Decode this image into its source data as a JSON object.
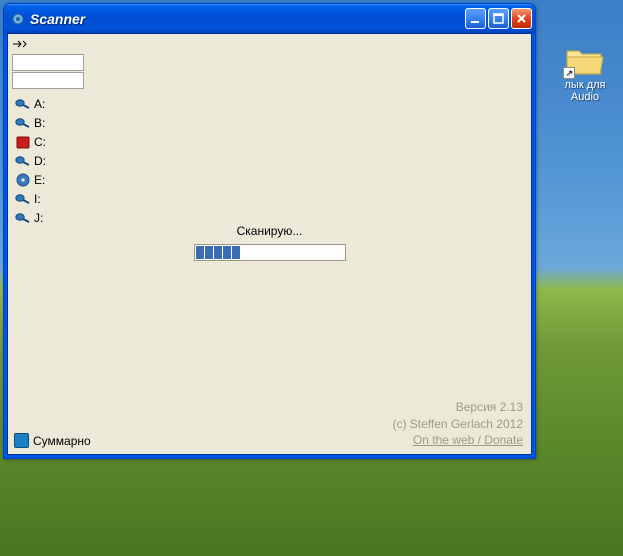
{
  "desktop": {
    "icon_label_line1": "лык для",
    "icon_label_line2": "Audio"
  },
  "window": {
    "title": "Scanner"
  },
  "drives": [
    {
      "label": "A:",
      "icon": "scanner"
    },
    {
      "label": "B:",
      "icon": "scanner"
    },
    {
      "label": "C:",
      "icon": "hdd-red"
    },
    {
      "label": "D:",
      "icon": "scanner"
    },
    {
      "label": "E:",
      "icon": "cd"
    },
    {
      "label": "I:",
      "icon": "scanner"
    },
    {
      "label": "J:",
      "icon": "scanner"
    }
  ],
  "scanning": {
    "label": "Сканирую...",
    "progress_segments": 5,
    "progress_max_segments": 16
  },
  "footer": {
    "summary_label": "Суммарно",
    "version": "Версия 2.13",
    "copyright": "(c) Steffen Gerlach 2012",
    "link": "On the web / Donate"
  }
}
